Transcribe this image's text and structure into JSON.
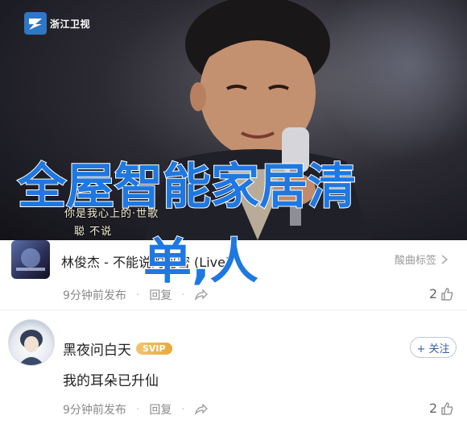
{
  "video": {
    "channel_logo_text": "浙江卫视",
    "lyric_line_1": "你是我心上的·世歌",
    "lyric_line_2": "聪 不说",
    "overlay_headline_1": "全屋智能家居清",
    "overlay_headline_2": "单,人"
  },
  "song_item": {
    "title": "林俊杰 - 不能说的秘密 (Live)",
    "tag_label": "酸曲标签",
    "time": "9分钟前发布",
    "reply_label": "回复",
    "like_count": "2"
  },
  "comment_item": {
    "username": "黑夜问白天",
    "badge": "SVIP",
    "follow_label": "+ 关注",
    "text": "我的耳朵已升仙",
    "time": "9分钟前发布",
    "reply_label": "回复",
    "like_count": "2"
  },
  "colors": {
    "headline": "#1e78e0",
    "svip_badge": "#e8a93a",
    "logo": "#2e76c6"
  }
}
